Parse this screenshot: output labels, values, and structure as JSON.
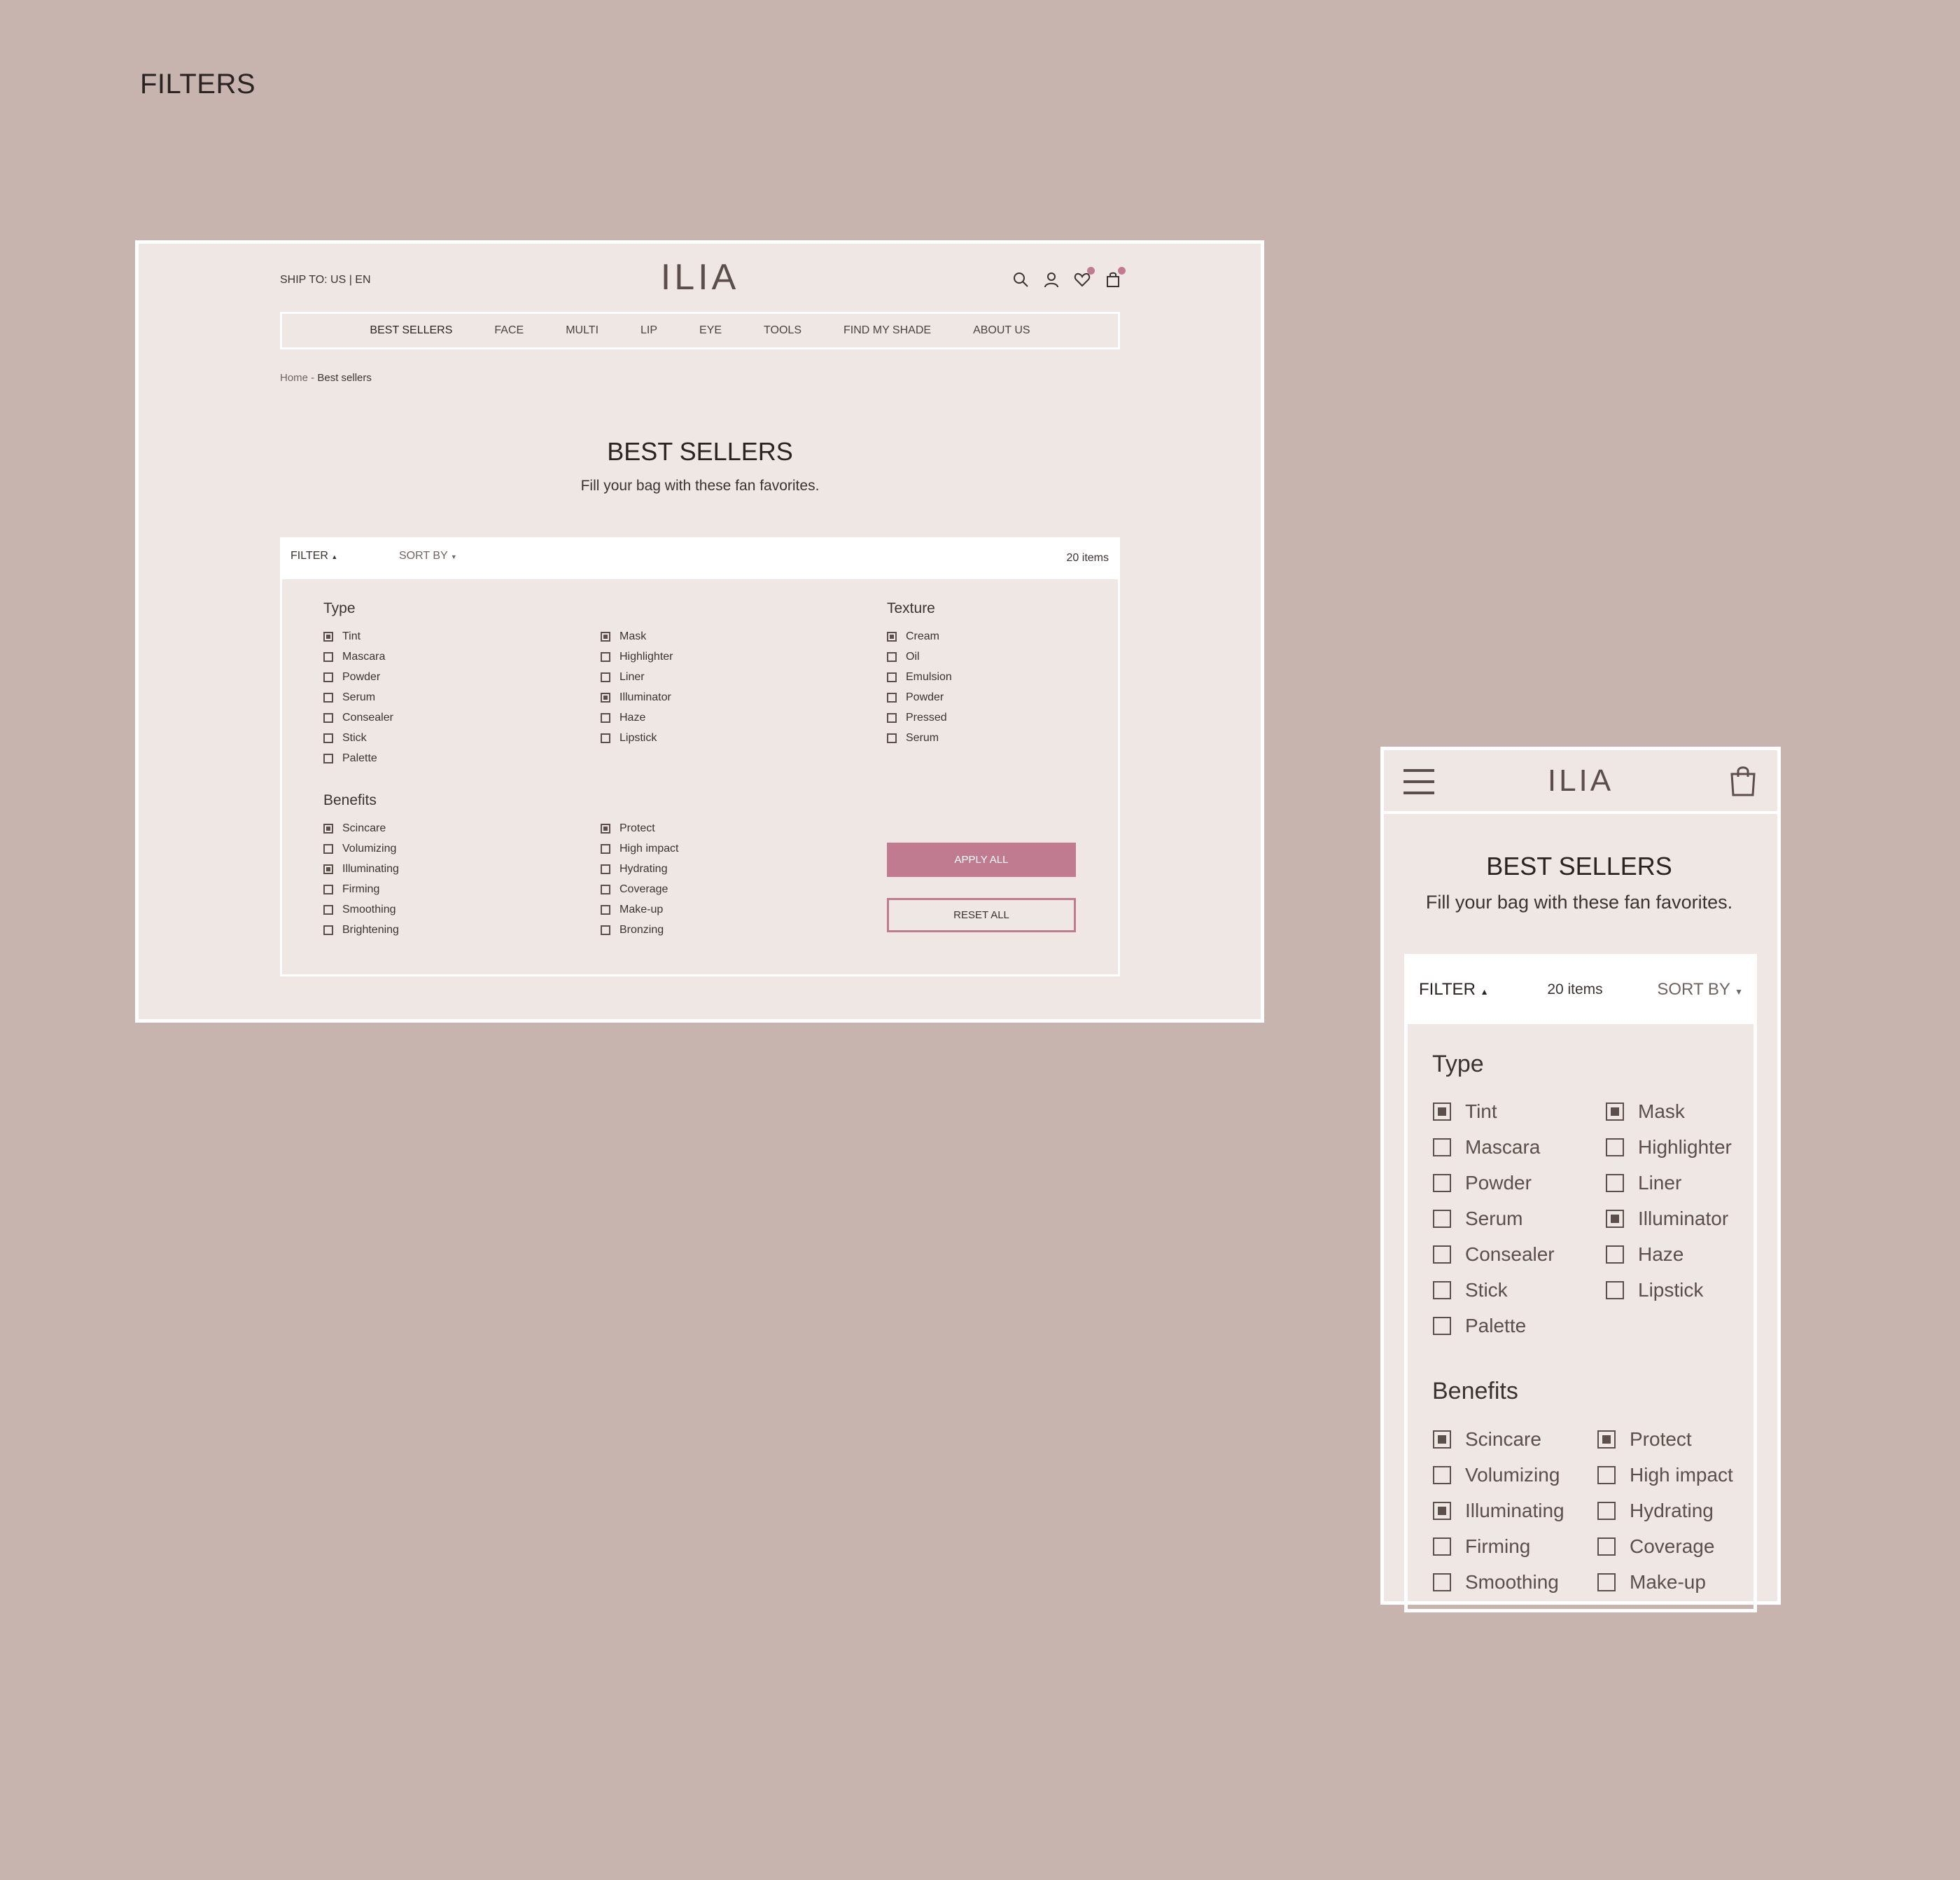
{
  "page_heading": "FILTERS",
  "brand": "ILIA",
  "colors": {
    "background": "#c8b4ae",
    "panel": "#efe7e4",
    "accent": "#c07b90",
    "text": "#3a3331"
  },
  "desktop": {
    "ship_to": "SHIP TO: US | EN",
    "icons": [
      "search-icon",
      "user-icon",
      "heart-icon",
      "bag-icon"
    ],
    "nav": [
      "BEST SELLERS",
      "FACE",
      "MULTI",
      "LIP",
      "EYE",
      "TOOLS",
      "FIND MY SHADE",
      "ABOUT US"
    ],
    "breadcrumb": {
      "home": "Home",
      "separator": " - ",
      "current": "Best sellers"
    },
    "title": "BEST SELLERS",
    "subtitle": "Fill your bag with these fan favorites.",
    "filter_label": "FILTER",
    "sort_label": "SORT BY",
    "item_count": "20 items",
    "type_title": "Type",
    "type_col1": [
      {
        "label": "Tint",
        "checked": true
      },
      {
        "label": "Mascara",
        "checked": false
      },
      {
        "label": "Powder",
        "checked": false
      },
      {
        "label": "Serum",
        "checked": false
      },
      {
        "label": "Consealer",
        "checked": false
      },
      {
        "label": "Stick",
        "checked": false
      },
      {
        "label": "Palette",
        "checked": false
      }
    ],
    "type_col2": [
      {
        "label": "Mask",
        "checked": true
      },
      {
        "label": "Highlighter",
        "checked": false
      },
      {
        "label": "Liner",
        "checked": false
      },
      {
        "label": "Illuminator",
        "checked": true
      },
      {
        "label": "Haze",
        "checked": false
      },
      {
        "label": "Lipstick",
        "checked": false
      }
    ],
    "texture_title": "Texture",
    "texture": [
      {
        "label": "Cream",
        "checked": true
      },
      {
        "label": "Oil",
        "checked": false
      },
      {
        "label": "Emulsion",
        "checked": false
      },
      {
        "label": "Powder",
        "checked": false
      },
      {
        "label": "Pressed",
        "checked": false
      },
      {
        "label": "Serum",
        "checked": false
      }
    ],
    "benefits_title": "Benefits",
    "benefits_col1": [
      {
        "label": "Scincare",
        "checked": true
      },
      {
        "label": "Volumizing",
        "checked": false
      },
      {
        "label": "Illuminating",
        "checked": true
      },
      {
        "label": "Firming",
        "checked": false
      },
      {
        "label": "Smoothing",
        "checked": false
      },
      {
        "label": "Brightening",
        "checked": false
      }
    ],
    "benefits_col2": [
      {
        "label": "Protect",
        "checked": true
      },
      {
        "label": "High impact",
        "checked": false
      },
      {
        "label": "Hydrating",
        "checked": false
      },
      {
        "label": "Coverage",
        "checked": false
      },
      {
        "label": "Make-up",
        "checked": false
      },
      {
        "label": "Bronzing",
        "checked": false
      }
    ],
    "apply_label": "APPLY ALL",
    "reset_label": "RESET ALL"
  },
  "mobile": {
    "icons": [
      "menu-icon",
      "bag-icon"
    ],
    "title": "BEST SELLERS",
    "subtitle": "Fill your bag with these fan favorites.",
    "filter_label": "FILTER",
    "item_count": "20 items",
    "sort_label": "SORT BY",
    "type_title": "Type",
    "type_col1": [
      {
        "label": "Tint",
        "checked": true
      },
      {
        "label": "Mascara",
        "checked": false
      },
      {
        "label": "Powder",
        "checked": false
      },
      {
        "label": "Serum",
        "checked": false
      },
      {
        "label": "Consealer",
        "checked": false
      },
      {
        "label": "Stick",
        "checked": false
      },
      {
        "label": "Palette",
        "checked": false
      }
    ],
    "type_col2": [
      {
        "label": "Mask",
        "checked": true
      },
      {
        "label": "Highlighter",
        "checked": false
      },
      {
        "label": "Liner",
        "checked": false
      },
      {
        "label": "Illuminator",
        "checked": true
      },
      {
        "label": "Haze",
        "checked": false
      },
      {
        "label": "Lipstick",
        "checked": false
      }
    ],
    "benefits_title": "Benefits",
    "benefits_col1": [
      {
        "label": "Scincare",
        "checked": true
      },
      {
        "label": "Volumizing",
        "checked": false
      },
      {
        "label": "Illuminating",
        "checked": true
      },
      {
        "label": "Firming",
        "checked": false
      },
      {
        "label": "Smoothing",
        "checked": false
      }
    ],
    "benefits_col2": [
      {
        "label": "Protect",
        "checked": true
      },
      {
        "label": "High impact",
        "checked": false
      },
      {
        "label": "Hydrating",
        "checked": false
      },
      {
        "label": "Coverage",
        "checked": false
      },
      {
        "label": "Make-up",
        "checked": false
      }
    ]
  }
}
